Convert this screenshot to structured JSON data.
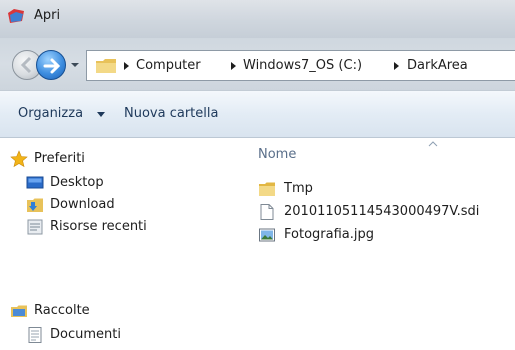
{
  "window": {
    "title": "Apri"
  },
  "address": {
    "crumbs": [
      "Computer",
      "Windows7_OS (C:)",
      "DarkArea"
    ]
  },
  "toolbar": {
    "organize_label": "Organizza",
    "new_folder_label": "Nuova cartella"
  },
  "nav": {
    "favorites": {
      "label": "Preferiti",
      "items": [
        "Desktop",
        "Download",
        "Risorse recenti"
      ]
    },
    "libraries": {
      "label": "Raccolte",
      "items": [
        "Documenti"
      ]
    }
  },
  "files": {
    "column_name": "Nome",
    "items": [
      {
        "name": "Tmp",
        "icon": "folder-icon"
      },
      {
        "name": "20101105114543000497V.sdi",
        "icon": "document-icon"
      },
      {
        "name": "Fotografia.jpg",
        "icon": "image-file-icon"
      }
    ]
  },
  "colors": {
    "toolbar_text": "#1e395b",
    "header_text": "#5a6f8a",
    "folder": "#e8c25a"
  }
}
